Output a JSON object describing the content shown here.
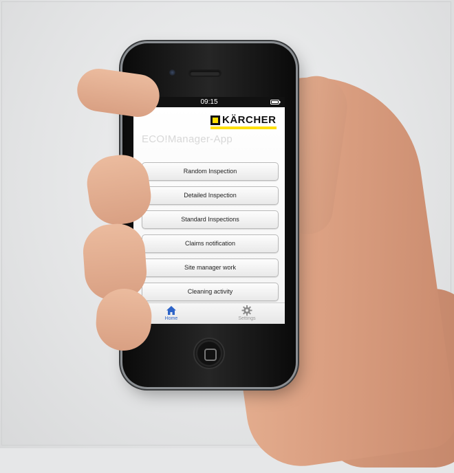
{
  "status_bar": {
    "time": "09:15"
  },
  "brand": {
    "logo_text": "KÄRCHER",
    "accent_color": "#ffe000"
  },
  "app": {
    "title": "ECO!Manager-App"
  },
  "menu": {
    "items": [
      {
        "label": "Random Inspection"
      },
      {
        "label": "Detailed Inspection"
      },
      {
        "label": "Standard Inspections"
      },
      {
        "label": "Claims notification"
      },
      {
        "label": "Site manager work"
      },
      {
        "label": "Cleaning activity"
      }
    ]
  },
  "tab_bar": {
    "tabs": [
      {
        "label": "Home",
        "icon": "house-icon",
        "active": true,
        "color": "#2d64c8"
      },
      {
        "label": "Settings",
        "icon": "gear-icon",
        "active": false,
        "color": "#999999"
      }
    ]
  },
  "status_icons": [
    "wifi-icon",
    "battery-icon"
  ]
}
